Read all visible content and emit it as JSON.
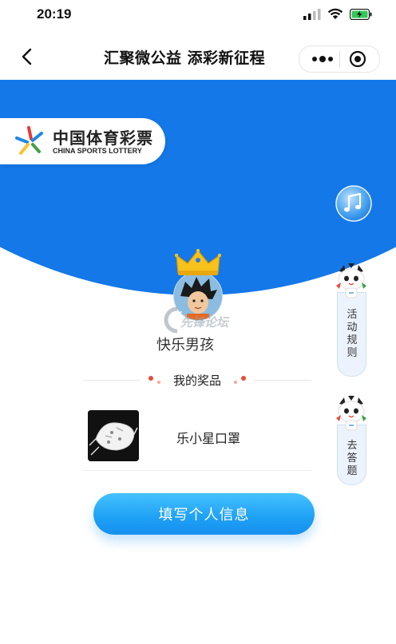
{
  "status_bar": {
    "time": "20:19"
  },
  "nav": {
    "title": "汇聚微公益 添彩新征程"
  },
  "logo": {
    "cn": "中国体育彩票",
    "en": "CHINA SPORTS LOTTERY"
  },
  "user": {
    "name": "快乐男孩"
  },
  "watermark": "先锋论坛",
  "prizes": {
    "title": "我的奖品",
    "items": [
      {
        "name": "乐小星口罩"
      }
    ]
  },
  "actions": {
    "fill_info": "填写个人信息"
  },
  "side": {
    "rules": "活动规则",
    "answer": "去答题"
  },
  "colors": {
    "brand_blue": "#1478e8",
    "button_blue": "#1ea0f5",
    "dot_red": "#e84c3d"
  }
}
